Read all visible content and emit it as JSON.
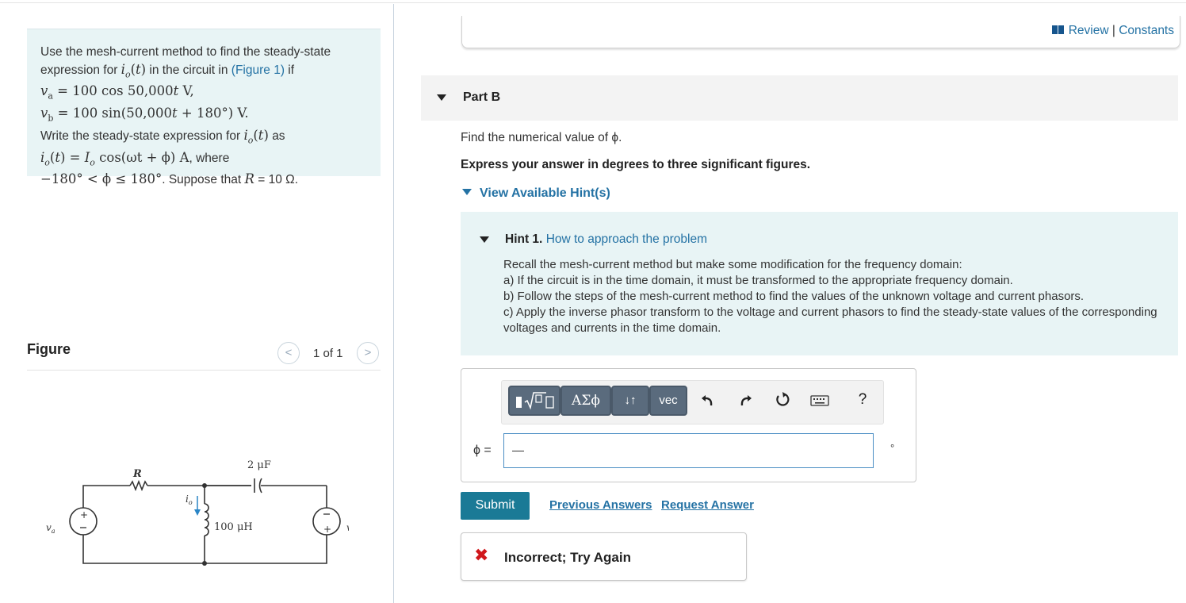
{
  "problem": {
    "intro": "Use the mesh-current method to find the steady-state expression for",
    "io_t": "i",
    "in_circuit": "in the circuit in",
    "figure_link": "(Figure 1)",
    "if_word": "if",
    "va_eq": "= 100 cos 50,000",
    "va_unit": "V,",
    "vb_eq": "= 100 sin(50,000",
    "vb_tail": "+ 180°) V.",
    "write_line": "Write the steady-state expression for",
    "as_word": "as",
    "io_expr": "cos(ωt + ϕ) A",
    "where_word": ", where",
    "range": "−180° < ϕ ≤ 180°",
    "suppose": ". Suppose that",
    "r_value": "= 10 Ω."
  },
  "figure": {
    "label": "Figure",
    "pager_text": "1 of 1",
    "prev_glyph": "<",
    "next_glyph": ">",
    "circuit_labels": {
      "R": "R",
      "cap": "2 μF",
      "ind": "100 μH",
      "io": "i",
      "va": "v",
      "vb": "v"
    }
  },
  "header": {
    "review": "Review",
    "separator": " | ",
    "constants": "Constants"
  },
  "partB": {
    "title": "Part B",
    "question": "Find the numerical value of ϕ.",
    "instruction": "Express your answer in degrees to three significant figures.",
    "hints_toggle": "View Available Hint(s)",
    "hint": {
      "number": "Hint 1.",
      "title": "How to approach the problem",
      "lines": [
        "Recall the mesh-current method but make some modification for the frequency domain:",
        "a) If the circuit is in the time domain, it must be transformed to the appropriate frequency domain.",
        "b) Follow the steps of the mesh-current method to find the values of the unknown voltage and current phasors.",
        "c) Apply the inverse phasor transform to the voltage and current phasors to find the steady-state values of the corresponding voltages and currents in the time domain."
      ]
    },
    "toolbar": {
      "greek": "ΑΣϕ",
      "arrows": "↓↑",
      "vec": "vec",
      "help": "?"
    },
    "phi_label": "ϕ =",
    "degree_unit": "°",
    "submit": "Submit",
    "previous_answers": "Previous Answers",
    "request_answer": "Request Answer",
    "feedback_icon": "✖",
    "feedback": "Incorrect; Try Again"
  }
}
